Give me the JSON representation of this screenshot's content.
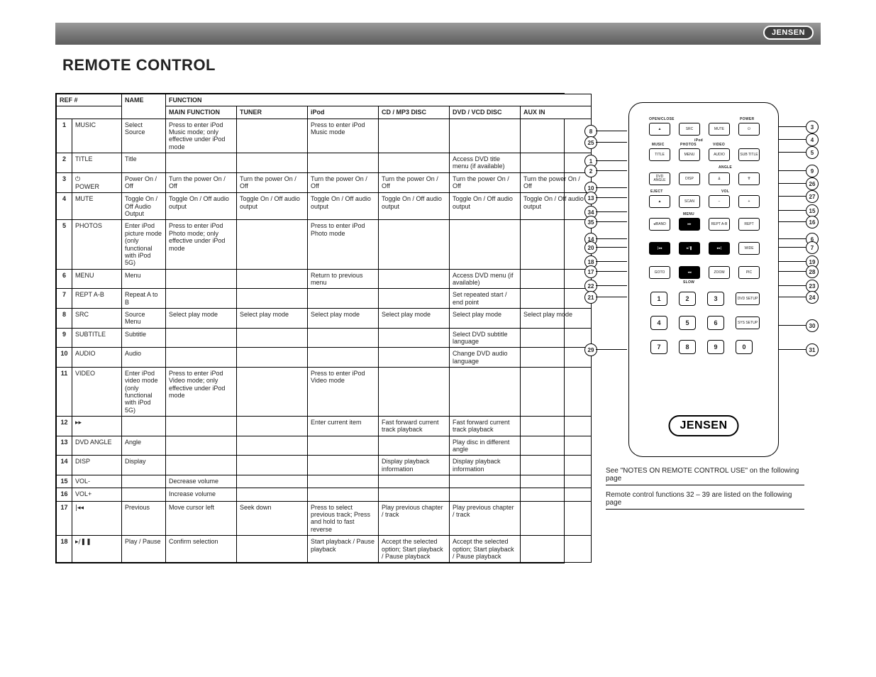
{
  "header": {
    "brand": "JENSEN",
    "title": "REMOTE CONTROL"
  },
  "table": {
    "head_top": [
      "REF #",
      "NAME",
      "FUNCTION"
    ],
    "head_modes": [
      "MAIN FUNCTION",
      "TUNER",
      "iPod",
      "CD / MP3 DISC",
      "DVD / VCD DISC",
      "AUX IN"
    ],
    "rows": [
      {
        "ref": "1",
        "sym": "",
        "name": "MUSIC",
        "fn": "Select Source",
        "cells": [
          "Press to enter iPod Music mode; only effective under iPod mode",
          "",
          "Press to enter iPod Music mode",
          "",
          "",
          ""
        ]
      },
      {
        "ref": "2",
        "sym": "",
        "name": "TITLE",
        "fn": "Title",
        "cells": [
          "",
          "",
          "",
          "",
          "Access DVD title menu (if available)",
          ""
        ]
      },
      {
        "ref": "3",
        "sym": "⏻",
        "name": "POWER",
        "fn": "Power On / Off",
        "cells": [
          "Turn the power On / Off",
          "Turn the power On / Off",
          "Turn the power On / Off",
          "Turn the power On / Off",
          "Turn the power On / Off",
          "Turn the power On / Off"
        ]
      },
      {
        "ref": "4",
        "sym": "",
        "name": "MUTE",
        "fn": "Toggle On / Off Audio Output",
        "cells": [
          "Toggle On / Off audio output",
          "Toggle On / Off audio output",
          "Toggle On / Off audio output",
          "Toggle On / Off audio output",
          "Toggle On / Off audio output",
          "Toggle On / Off audio output"
        ]
      },
      {
        "ref": "5",
        "sym": "",
        "name": "PHOTOS",
        "fn": "Enter iPod picture mode (only functional with iPod 5G)",
        "cells": [
          "Press to enter iPod Photo mode; only effective under iPod mode",
          "",
          "Press to enter iPod Photo mode",
          "",
          "",
          ""
        ]
      },
      {
        "ref": "6",
        "sym": "",
        "name": "MENU",
        "fn": "Menu",
        "cells": [
          "",
          "",
          "Return to previous menu",
          "",
          "Access DVD menu (if available)",
          ""
        ]
      },
      {
        "ref": "7",
        "sym": "",
        "name": "REPT A-B",
        "fn": "Repeat A to B",
        "cells": [
          "",
          "",
          "",
          "",
          "Set repeated start / end point",
          ""
        ]
      },
      {
        "ref": "8",
        "sym": "",
        "name": "SRC",
        "fn": "Source Menu",
        "cells": [
          "Select play mode",
          "Select play mode",
          "Select play mode",
          "Select play mode",
          "Select play mode",
          "Select play mode"
        ]
      },
      {
        "ref": "9",
        "sym": "",
        "name": "SUBTITLE",
        "fn": "Subtitle",
        "cells": [
          "",
          "",
          "",
          "",
          "Select DVD subtitle language",
          ""
        ]
      },
      {
        "ref": "10",
        "sym": "",
        "name": "AUDIO",
        "fn": "Audio",
        "cells": [
          "",
          "",
          "",
          "",
          "Change DVD audio language",
          ""
        ]
      },
      {
        "ref": "11",
        "sym": "",
        "name": "VIDEO",
        "fn": "Enter iPod video mode (only functional with iPod 5G)",
        "cells": [
          "Press to enter iPod Video mode; only effective under iPod mode",
          "",
          "Press to enter iPod Video mode",
          "",
          "",
          ""
        ]
      },
      {
        "ref": "12",
        "sym": "▸▸",
        "name": "",
        "fn": "",
        "cells": [
          "",
          "",
          "Enter current item",
          "Fast forward current track playback",
          "Fast forward current track playback",
          ""
        ]
      },
      {
        "ref": "13",
        "sym": "",
        "name": "DVD ANGLE",
        "fn": "Angle",
        "cells": [
          "",
          "",
          "",
          "",
          "Play disc in different angle",
          ""
        ]
      },
      {
        "ref": "14",
        "sym": "",
        "name": "DISP",
        "fn": "Display",
        "cells": [
          "",
          "",
          "",
          "Display playback information",
          "Display playback information",
          ""
        ]
      },
      {
        "ref": "15",
        "sym": "",
        "name": "VOL-",
        "fn": "",
        "cells": [
          "Decrease volume",
          "",
          "",
          "",
          "",
          ""
        ]
      },
      {
        "ref": "16",
        "sym": "",
        "name": "VOL+",
        "fn": "",
        "cells": [
          "Increase volume",
          "",
          "",
          "",
          "",
          ""
        ]
      },
      {
        "ref": "17",
        "sym": "|◂◂",
        "name": "",
        "fn": "Previous",
        "cells": [
          "Move cursor left",
          "Seek down",
          "Press to select previous track; Press and hold to fast reverse",
          "Play previous chapter / track",
          "Play previous chapter / track",
          ""
        ]
      },
      {
        "ref": "18",
        "sym": "▸/❚❚",
        "name": "",
        "fn": "Play / Pause",
        "cells": [
          "Confirm selection",
          "",
          "Start playback / Pause playback",
          "Accept the selected option; Start playback / Pause playback",
          "Accept the selected option; Start playback / Pause playback",
          ""
        ]
      }
    ]
  },
  "remote": {
    "labels": {
      "open_close": "OPEN/CLOSE",
      "power": "POWER",
      "ipod": "iPod",
      "music": "MUSIC",
      "photos": "PHOTOS",
      "video": "VIDEO",
      "angle": "ANGLE",
      "eject": "EJECT",
      "vol": "VOL",
      "menu": "MENU",
      "slow": "SLOW"
    },
    "buttons": {
      "eject_top": "▲",
      "src": "SRC",
      "mute": "MUTE",
      "power": "⏻",
      "title": "TITLE",
      "menu": "MENU",
      "audio": "AUDIO",
      "subtitle": "SUB TITLE",
      "dvd_angle": "DVD ANGLE",
      "disp": "DISP",
      "angle_dn": "⇊",
      "angle_up": "⇈",
      "eject": "▲",
      "scan": "SCAN",
      "vol_dn": "−",
      "vol_up": "+",
      "band": "◂/BAND",
      "ff": "▸▸",
      "rept_ab": "REPT A-B",
      "rept": "REPT",
      "prev": "|◂◂",
      "play": "▸/❚",
      "next": "▸▸|",
      "wide": "WIDE",
      "goto": "GOTO",
      "rew": "◂◂",
      "zoom": "ZOOM",
      "pic": "PIC",
      "n1": "1",
      "n2": "2",
      "n3": "3",
      "dvd_setup": "DVD SETUP",
      "n4": "4",
      "n5": "5",
      "n6": "6",
      "sys_setup": "SYS SETUP",
      "n7": "7",
      "n8": "8",
      "n9": "9",
      "n0": "0"
    },
    "callouts_left": [
      "8",
      "25",
      "1",
      "2",
      "10",
      "13",
      "34",
      "35",
      "14",
      "20",
      "18",
      "17",
      "22",
      "21",
      "29"
    ],
    "callouts_right": [
      "3",
      "4",
      "5",
      "9",
      "26",
      "27",
      "15",
      "16",
      "6",
      "7",
      "19",
      "28",
      "23",
      "24",
      "30",
      "31"
    ],
    "notes": {
      "line1": "See \"NOTES ON REMOTE CONTROL USE\" on the following page",
      "line2": "Remote control functions 32 – 39 are listed on the following page"
    },
    "logo": "JENSEN"
  }
}
